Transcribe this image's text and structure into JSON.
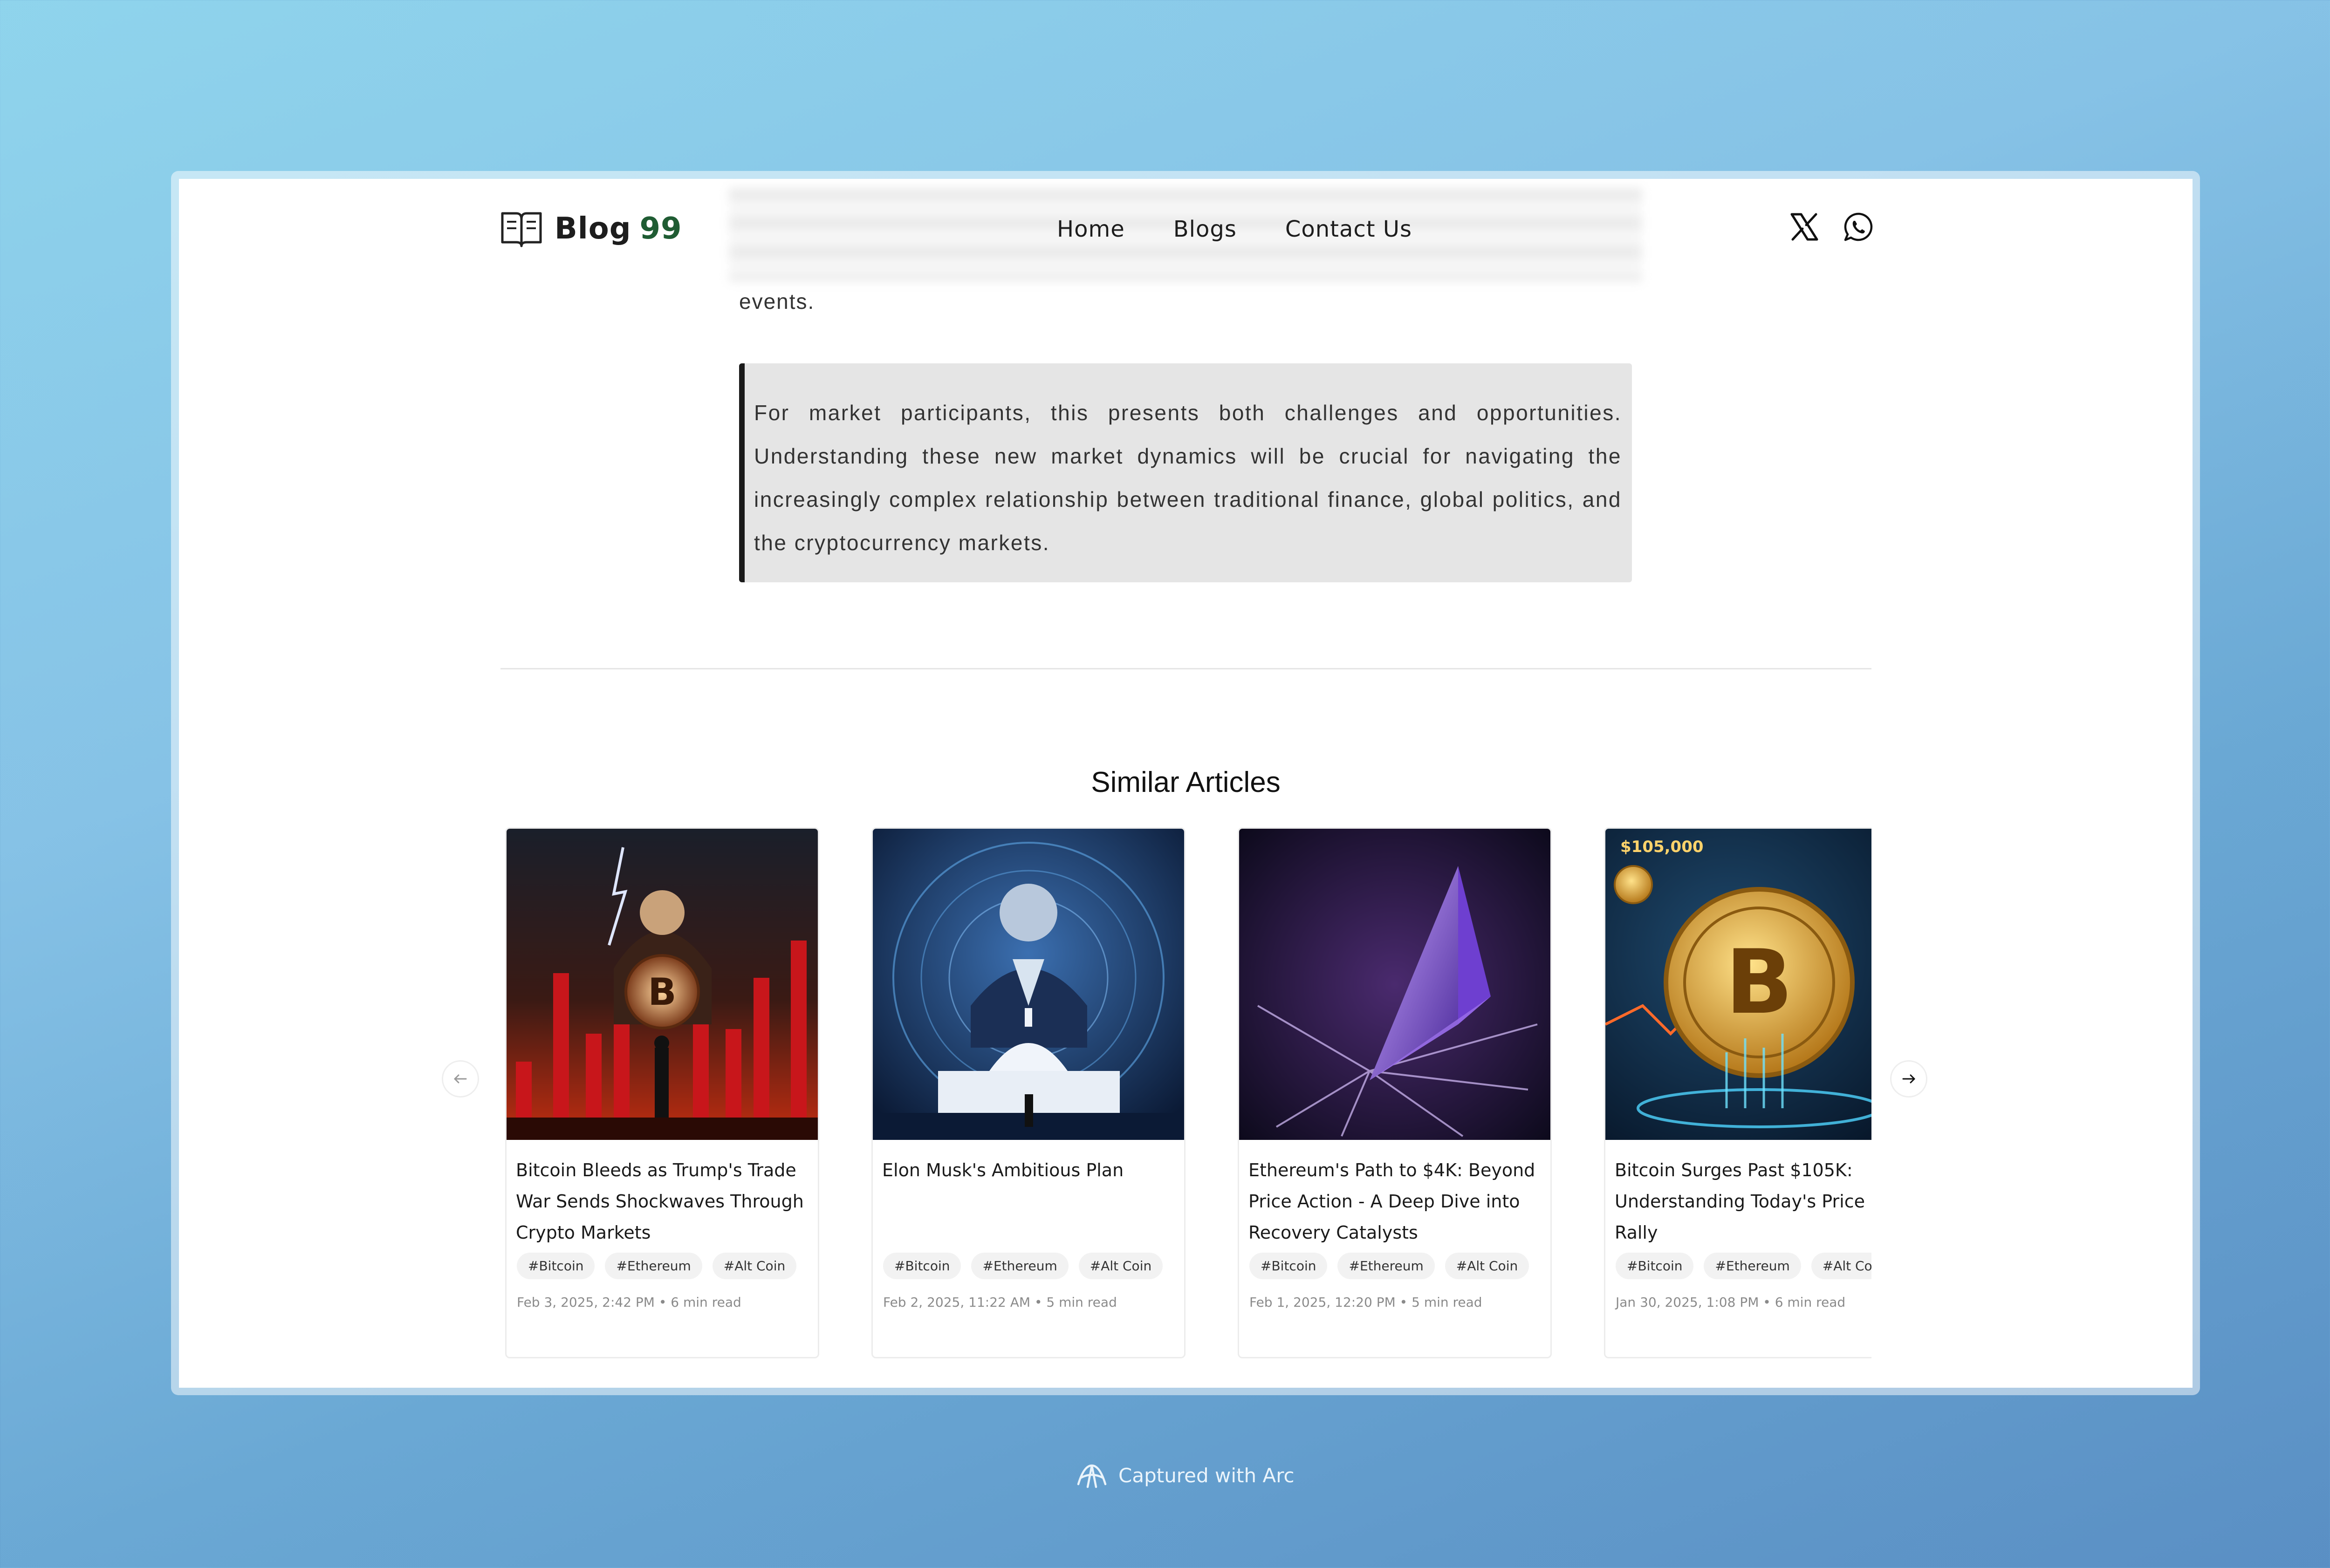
{
  "brand": {
    "name": "Blog",
    "number": "99",
    "accent": "#1f5c33"
  },
  "nav": {
    "home": "Home",
    "blogs": "Blogs",
    "contact": "Contact Us"
  },
  "social": {
    "x_icon": "x-logo-icon",
    "whatsapp_icon": "whatsapp-icon"
  },
  "article": {
    "trailing_text": "events.",
    "quote": "For market participants, this presents both challenges and opportunities. Understanding these new market dynamics will be crucial for navigating the increasingly complex relationship between traditional finance, global politics, and the cryptocurrency markets."
  },
  "similar": {
    "title": "Similar Articles",
    "cards": [
      {
        "title": "Bitcoin Bleeds as Trump's Trade War Sends Shockwaves Through Crypto Markets",
        "tags": [
          "#Bitcoin",
          "#Ethereum",
          "#Alt Coin"
        ],
        "meta": "Feb 3, 2025, 2:42 PM • 6 min read"
      },
      {
        "title": "Elon Musk's Ambitious Plan",
        "tags": [
          "#Bitcoin",
          "#Ethereum",
          "#Alt Coin"
        ],
        "meta": "Feb 2, 2025, 11:22 AM • 5 min read"
      },
      {
        "title": "Ethereum's Path to $4K: Beyond Price Action - A Deep Dive into Recovery Catalysts",
        "tags": [
          "#Bitcoin",
          "#Ethereum",
          "#Alt Coin"
        ],
        "meta": "Feb 1, 2025, 12:20 PM • 5 min read"
      },
      {
        "title": "Bitcoin Surges Past $105K: Understanding Today's Price Rally",
        "tags": [
          "#Bitcoin",
          "#Ethereum",
          "#Alt Coin"
        ],
        "meta": "Jan 30, 2025, 1:08 PM • 6 min read",
        "image_text": "$105,000"
      }
    ]
  },
  "footer": {
    "capture": "Captured with Arc"
  }
}
